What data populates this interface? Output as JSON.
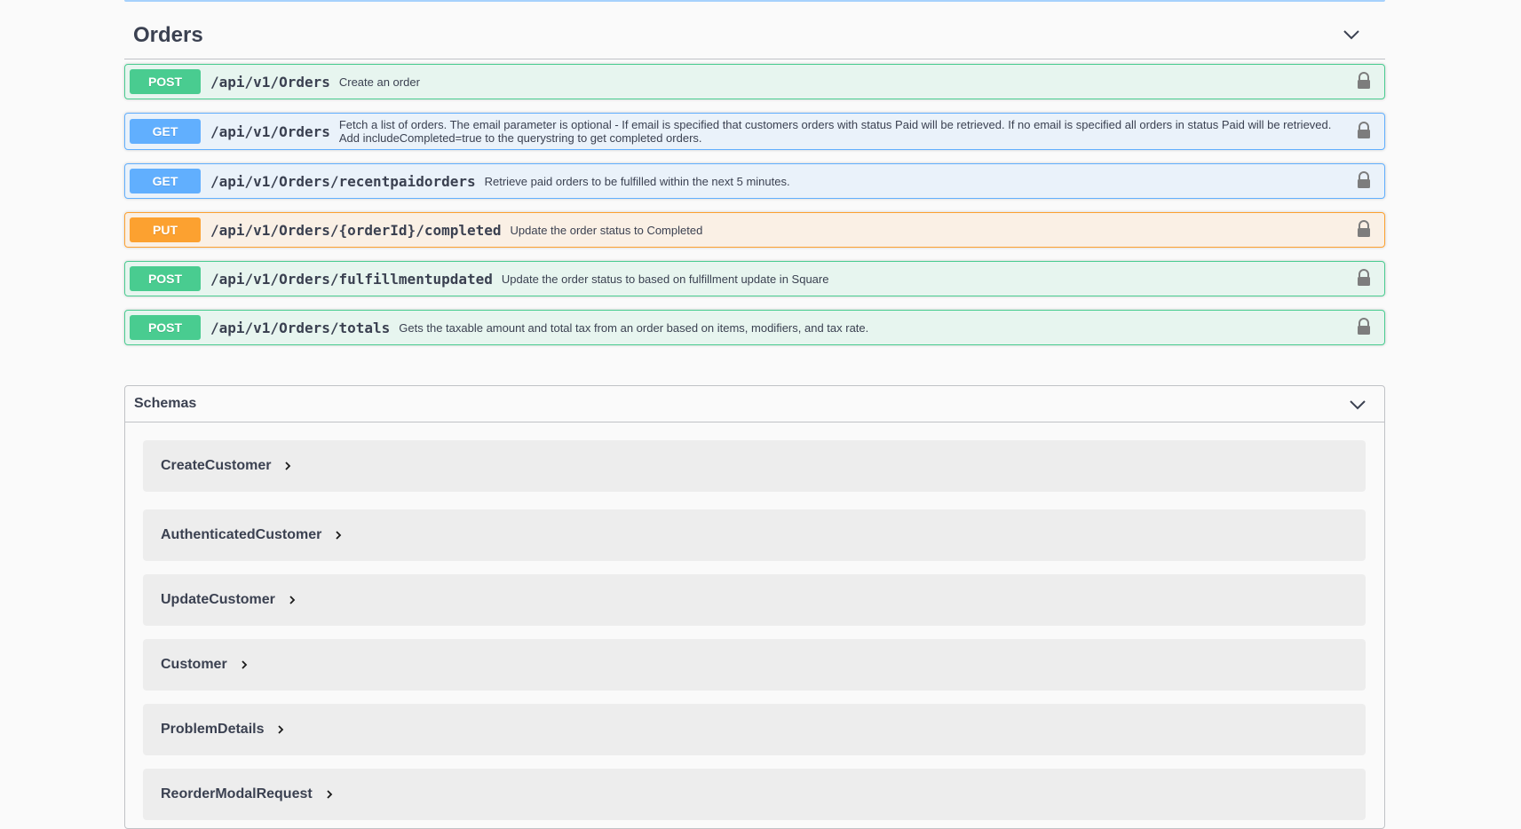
{
  "tag": {
    "title": "Orders"
  },
  "operations": [
    {
      "method": "POST",
      "path": "/api/v1/Orders",
      "summary": "Create an order"
    },
    {
      "method": "GET",
      "path": "/api/v1/Orders",
      "summary": "Fetch a list of orders. The email parameter is optional - If email is specified that customers orders with status Paid will be retrieved. If no email is specified all orders in status Paid will be retrieved. Add includeCompleted=true to the querystring to get completed orders."
    },
    {
      "method": "GET",
      "path": "/api/v1/Orders/recentpaidorders",
      "summary": "Retrieve paid orders to be fulfilled within the next 5 minutes."
    },
    {
      "method": "PUT",
      "path": "/api/v1/Orders/{orderId}/completed",
      "summary": "Update the order status to Completed"
    },
    {
      "method": "POST",
      "path": "/api/v1/Orders/fulfillmentupdated",
      "summary": "Update the order status to based on fulfillment update in Square"
    },
    {
      "method": "POST",
      "path": "/api/v1/Orders/totals",
      "summary": "Gets the taxable amount and total tax from an order based on items, modifiers, and tax rate."
    }
  ],
  "schemas": {
    "title": "Schemas",
    "models": [
      {
        "name": "CreateCustomer"
      },
      {
        "name": "AuthenticatedCustomer"
      },
      {
        "name": "UpdateCustomer"
      },
      {
        "name": "Customer"
      },
      {
        "name": "ProblemDetails"
      },
      {
        "name": "ReorderModalRequest"
      }
    ]
  },
  "colors": {
    "post": "#49cc90",
    "get": "#61affe",
    "put": "#fca130",
    "text": "#3b4151"
  },
  "icons": {
    "tag_toggle": "chevron-down-icon",
    "operation_auth": "lock-icon",
    "model_expand": "chevron-right-icon"
  }
}
